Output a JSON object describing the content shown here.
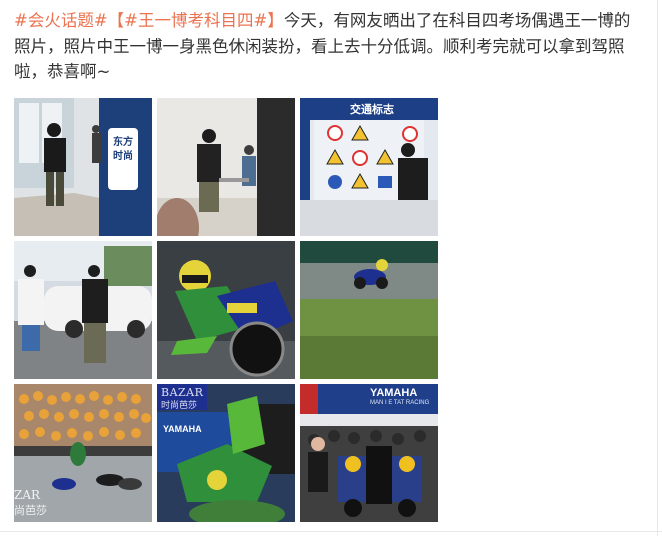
{
  "post": {
    "topic_1": "#会火话题#",
    "topic_2": "【#王一博考科目四#】",
    "body": "今天，有网友晒出了在科目四考场偶遇王一博的照片，照片中王一博一身黑色休闲装扮，看上去十分低调。顺利考完就可以拿到驾照啦，恭喜啊~"
  },
  "images": [
    {
      "sign_label": "东方时尚",
      "alt": "photo-hallway-sign"
    },
    {
      "sign_label": "",
      "alt": "photo-exam-room"
    },
    {
      "sign_label": "交通标志",
      "alt": "photo-traffic-signs-wall"
    },
    {
      "sign_label": "",
      "alt": "photo-white-car"
    },
    {
      "sign_label": "",
      "alt": "photo-green-rider-lean"
    },
    {
      "sign_label": "",
      "alt": "photo-track-rider"
    },
    {
      "watermark": "ZAR",
      "watermark_sub": "尚芭莎",
      "alt": "photo-grandstand"
    },
    {
      "watermark": "BAZAR",
      "watermark_sub": "时尚芭莎",
      "brand": "YAMAHA",
      "alt": "photo-rider-closeup"
    },
    {
      "brand": "YAMAHA",
      "team_sub": "MAN I E TAT RACING",
      "alt": "photo-team-group"
    }
  ],
  "colors": {
    "topic": "#eb7350",
    "text": "#333333"
  }
}
